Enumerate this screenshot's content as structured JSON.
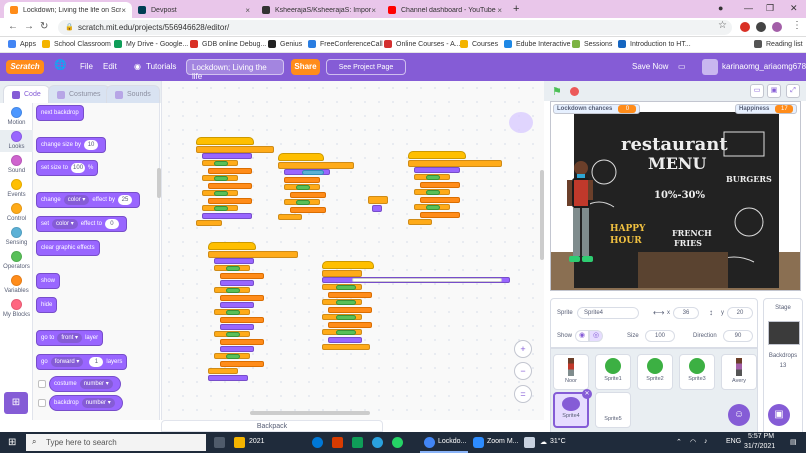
{
  "browser": {
    "tabs": [
      {
        "title": "Lockdown; Living the life on Scra",
        "active": true,
        "color": "#ff8c1a"
      },
      {
        "title": "Devpost",
        "active": false,
        "color": "#003e54"
      },
      {
        "title": "KsheerajaS/KsheerajaS: Import a",
        "active": false,
        "color": "#333"
      },
      {
        "title": "Channel dashboard - YouTube St",
        "active": false,
        "color": "#ff0000"
      }
    ],
    "new_tab": "+",
    "url": "scratch.mit.edu/projects/556946628/editor/",
    "bookmarks": [
      {
        "label": "Apps",
        "color": "#4285f4"
      },
      {
        "label": "School Classroom",
        "color": "#f4b400"
      },
      {
        "label": "My Drive - Google...",
        "color": "#0f9d58"
      },
      {
        "label": "GDB online Debug...",
        "color": "#d93025"
      },
      {
        "label": "Genius",
        "color": "#222"
      },
      {
        "label": "FreeConferenceCall",
        "color": "#2a7de1"
      },
      {
        "label": "Online Courses - A...",
        "color": "#d32f2f"
      },
      {
        "label": "Courses",
        "color": "#f4b400"
      },
      {
        "label": "Edube Interactive",
        "color": "#1e88e5"
      },
      {
        "label": "Sessions",
        "color": "#7cb342"
      },
      {
        "label": "Introduction to HT...",
        "color": "#1565c0"
      },
      {
        "label": "Reading list",
        "color": "#555"
      }
    ]
  },
  "scratch": {
    "logo": "Scratch",
    "menu": {
      "file": "File",
      "edit": "Edit",
      "tutorials": "Tutorials"
    },
    "project_title": "Lockdown; Living the life",
    "share": "Share",
    "see_project": "See Project Page",
    "save_now": "Save Now",
    "username": "karinaomg_ariaomg678",
    "editor_tabs": {
      "code": "Code",
      "costumes": "Costumes",
      "sounds": "Sounds"
    },
    "categories": [
      {
        "label": "Motion",
        "color": "#4c97ff"
      },
      {
        "label": "Looks",
        "color": "#9966ff"
      },
      {
        "label": "Sound",
        "color": "#cf63cf"
      },
      {
        "label": "Events",
        "color": "#ffbf00"
      },
      {
        "label": "Control",
        "color": "#ffab19"
      },
      {
        "label": "Sensing",
        "color": "#5cb1d6"
      },
      {
        "label": "Operators",
        "color": "#59c059"
      },
      {
        "label": "Variables",
        "color": "#ff8c1a"
      },
      {
        "label": "My Blocks",
        "color": "#ff6680"
      }
    ],
    "palette": {
      "next_backdrop": "next backdrop",
      "change_size": "change size by",
      "change_size_val": "10",
      "set_size": "set size to",
      "set_size_val": "100",
      "set_size_unit": "%",
      "change_effect": "change",
      "change_effect_dd": "color",
      "change_effect_by": "effect by",
      "change_effect_val": "25",
      "set_effect": "set",
      "set_effect_dd": "color",
      "set_effect_to": "effect to",
      "set_effect_val": "0",
      "clear_effects": "clear graphic effects",
      "show": "show",
      "hide": "hide",
      "go_to": "go to",
      "go_to_dd": "front",
      "go_to_layer": "layer",
      "go": "go",
      "go_dd": "forward",
      "go_val": "1",
      "go_layers": "layers",
      "costume": "costume",
      "costume_dd": "number",
      "backdrop": "backdrop",
      "backdrop_dd": "number"
    },
    "backpack": "Backpack",
    "zoom": {
      "in": "+",
      "out": "−",
      "reset": "="
    },
    "stage": {
      "monitors": [
        {
          "label": "Lockdown chances",
          "value": "0"
        },
        {
          "label": "Happiness",
          "value": "17"
        }
      ],
      "chalk_texts": [
        "restaurant",
        "MENU",
        "10%-30%",
        "BURGERS",
        "HAPPY",
        "HOUR",
        "FRENCH",
        "FRIES"
      ]
    },
    "sprite_info": {
      "sprite_label": "Sprite",
      "sprite_name": "Sprite4",
      "x_label": "x",
      "x_value": "36",
      "y_label": "y",
      "y_value": "20",
      "show_label": "Show",
      "size_label": "Size",
      "size_value": "100",
      "direction_label": "Direction",
      "direction_value": "90"
    },
    "sprites": [
      {
        "name": "Noor",
        "color": "#8a4b2f"
      },
      {
        "name": "Sprite1",
        "color": "#3cb043"
      },
      {
        "name": "Sprite2",
        "color": "#3cb043"
      },
      {
        "name": "Sprite3",
        "color": "#3cb043"
      },
      {
        "name": "Avery",
        "color": "#a35fa8"
      },
      {
        "name": "Sprite4",
        "color": "#855cd6"
      },
      {
        "name": "Sprite5",
        "color": "#ffffff"
      }
    ],
    "stage_panel": {
      "label": "Stage",
      "backdrops_label": "Backdrops",
      "backdrops_count": "13"
    }
  },
  "taskbar": {
    "search_placeholder": "Type here to search",
    "items": [
      {
        "label": "2021",
        "color": "#f4b400"
      },
      {
        "label": "Lockdo...",
        "color": "#4285f4"
      },
      {
        "label": "Zoom M...",
        "color": "#2d8cff"
      }
    ],
    "weather": "31°C",
    "lang": "ENG",
    "time": "5:57 PM",
    "date": "31/7/2021"
  }
}
